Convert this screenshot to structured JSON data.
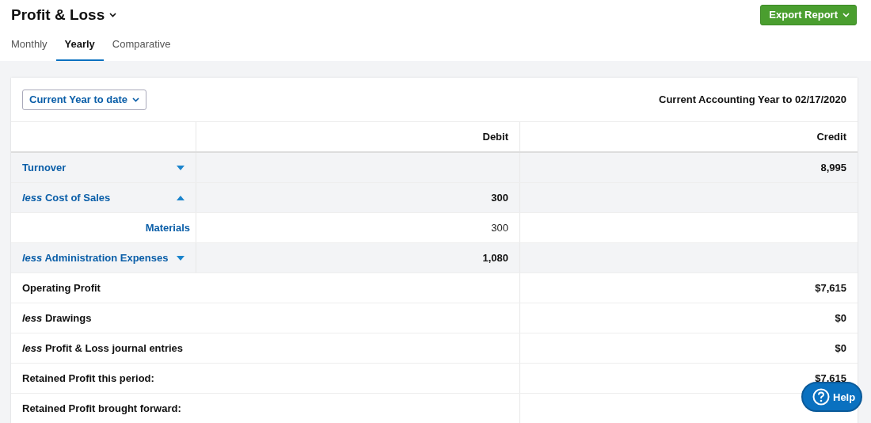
{
  "title": "Profit & Loss",
  "export_button": "Export Report",
  "tabs": [
    {
      "label": "Monthly",
      "selected": false
    },
    {
      "label": "Yearly",
      "selected": true
    },
    {
      "label": "Comparative",
      "selected": false
    }
  ],
  "period_dropdown": "Current Year to date",
  "period_text": "Current Accounting Year to 02/17/2020",
  "columns": [
    "Debit",
    "Credit"
  ],
  "rows": [
    {
      "kind": "group",
      "label": "Turnover",
      "expanded": false,
      "debit": "",
      "credit": "8,995"
    },
    {
      "kind": "group",
      "label": "*less* Cost of Sales",
      "expanded": true,
      "debit": "300",
      "credit": ""
    },
    {
      "kind": "item",
      "label": "Materials",
      "debit": "300",
      "credit": ""
    },
    {
      "kind": "group",
      "label": "*less* Administration Expenses",
      "expanded": false,
      "debit": "1,080",
      "credit": ""
    },
    {
      "kind": "total",
      "label": "Operating Profit",
      "credit": "$7,615"
    },
    {
      "kind": "total",
      "label": "*less* Drawings",
      "credit": "$0"
    },
    {
      "kind": "total",
      "label": "*less* Profit & Loss journal entries",
      "credit": "$0"
    },
    {
      "kind": "total",
      "label": "Retained Profit this period:",
      "credit": "$7,615"
    },
    {
      "kind": "total",
      "label": "Retained Profit brought forward:",
      "credit": ""
    }
  ],
  "help_button": "Help"
}
